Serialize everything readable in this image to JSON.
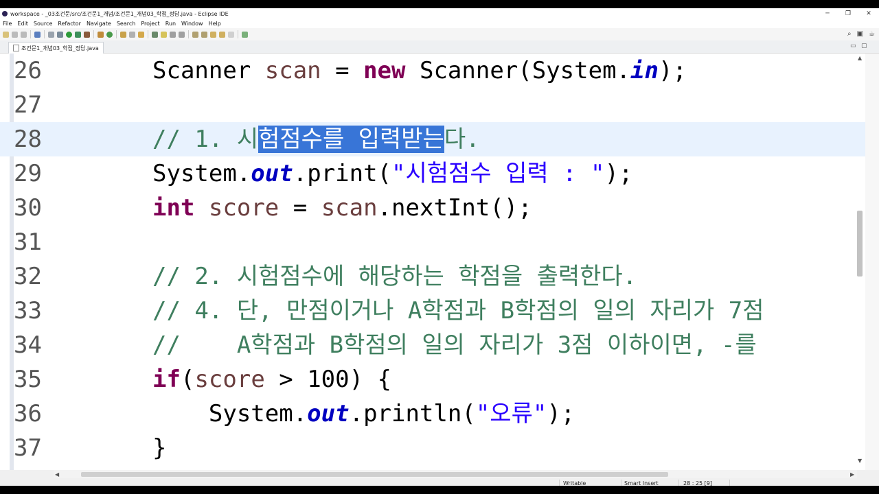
{
  "window": {
    "title": "workspace - _03조건문/src/조건문1_개념/조건문1_개념03_학점_정답.java - Eclipse IDE",
    "minimize": "─",
    "restore": "❐",
    "close": "✕"
  },
  "menu": [
    "File",
    "Edit",
    "Source",
    "Refactor",
    "Navigate",
    "Search",
    "Project",
    "Run",
    "Window",
    "Help"
  ],
  "editor_tab": {
    "label": "조건문1_개념03_학점_정답.java",
    "minimize": "▭",
    "maximize": "▢"
  },
  "code_lines": [
    {
      "num": "26"
    },
    {
      "num": "27"
    },
    {
      "num": "28",
      "before": "// 1. 시",
      "selected": "험점수를 입력받는",
      "after": "다."
    },
    {
      "num": "29",
      "string": "\"시험점수 입력 : \""
    },
    {
      "num": "30"
    },
    {
      "num": "31"
    },
    {
      "num": "32",
      "comment": "// 2. 시험점수에 해당하는 학점을 출력한다."
    },
    {
      "num": "33",
      "comment": "// 4. 단, 만점이거나 A학점과 B학점의 일의 자리가 7점"
    },
    {
      "num": "34",
      "comment": "//    A학점과 B학점의 일의 자리가 3점 이하이면, -를"
    },
    {
      "num": "35"
    },
    {
      "num": "36",
      "string": "\"오류\""
    },
    {
      "num": "37"
    }
  ],
  "status": {
    "writable": "Writable",
    "insert_mode": "Smart Insert",
    "position": "28 : 25 [9]"
  }
}
